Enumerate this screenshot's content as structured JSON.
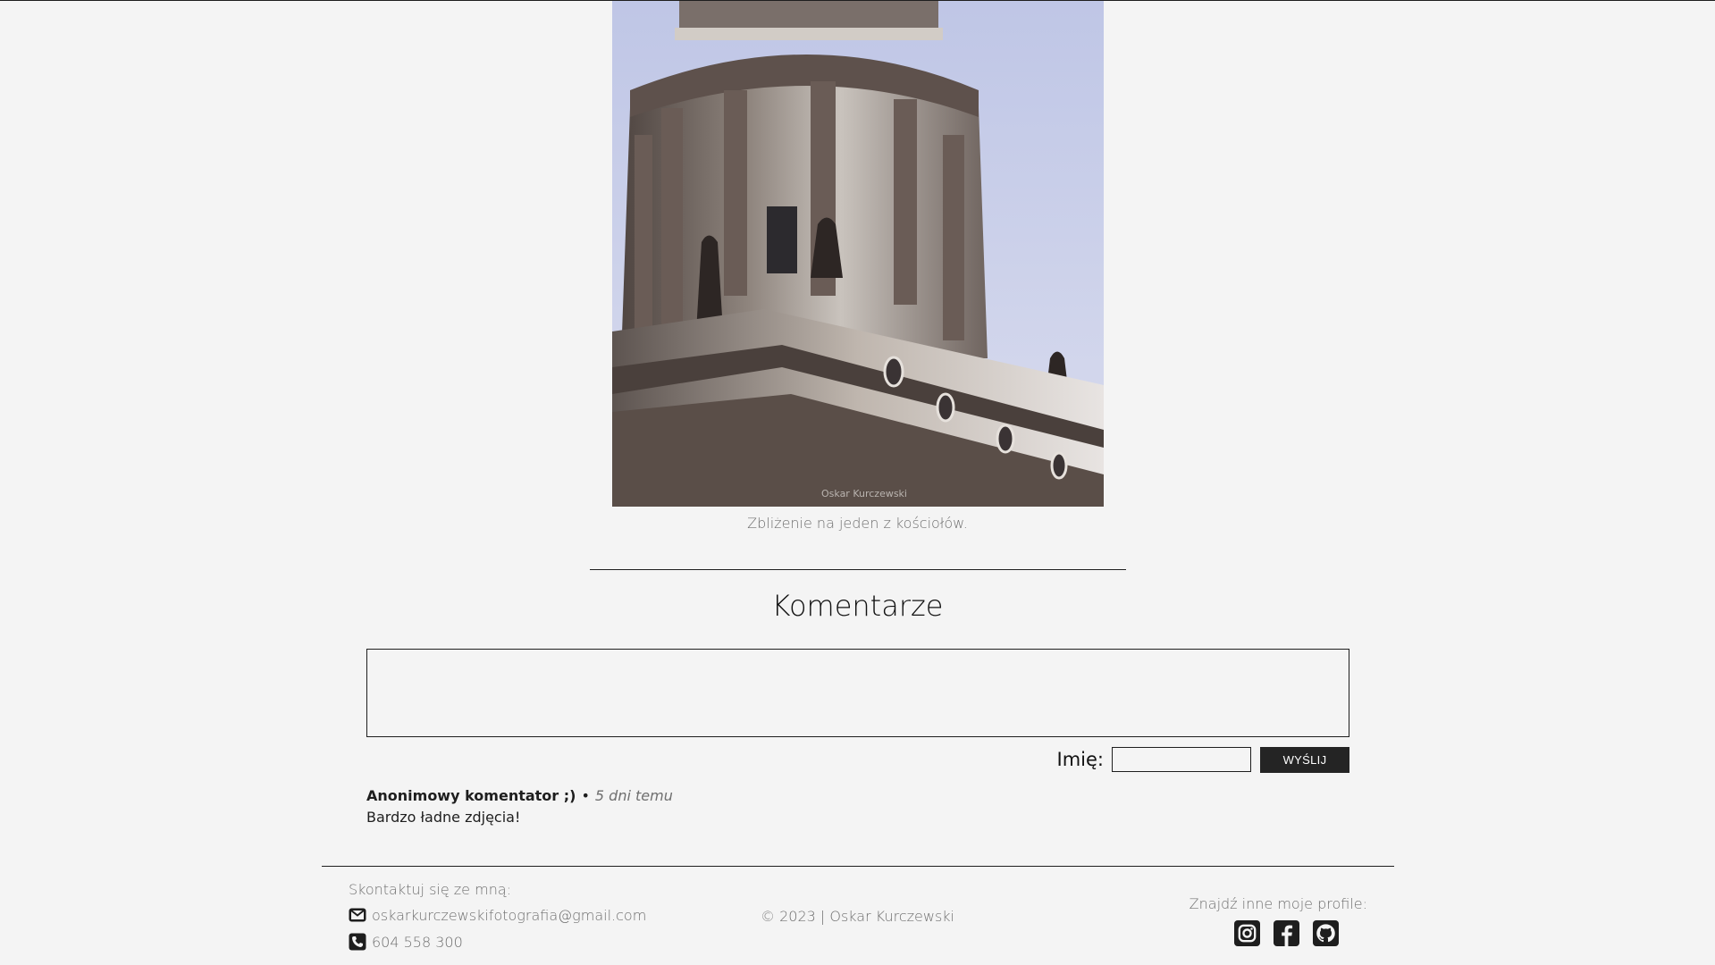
{
  "photo": {
    "watermark": "Oskar Kurczewski",
    "caption": "Zbliżenie na jeden z kościołów."
  },
  "comments": {
    "title": "Komentarze",
    "textarea_value": "",
    "name_label": "Imię:",
    "name_value": "",
    "send_label": "WYŚLIJ",
    "items": [
      {
        "author": "Anonimowy komentator ;)",
        "separator": "•",
        "time": "5 dni temu",
        "text": "Bardzo ładne zdjęcia!"
      }
    ]
  },
  "footer": {
    "contact_title": "Skontaktuj się ze mną:",
    "email": "oskarkurczewskifotografia@gmail.com",
    "phone": "604 558 300",
    "copyright": "© 2023 | Oskar Kurczewski",
    "profiles_title": "Znajdź inne moje profile:",
    "profiles": [
      "instagram-icon",
      "facebook-icon",
      "github-icon"
    ]
  },
  "colors": {
    "background": "#f4f4f4",
    "text": "#1e1e1e",
    "muted": "#6f6f6f",
    "button": "#242424"
  }
}
